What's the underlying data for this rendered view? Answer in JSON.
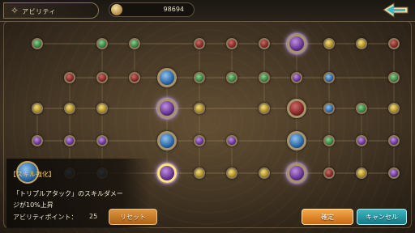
{
  "header": {
    "title": "アビリティ",
    "coin_count": "98694",
    "back_icon": "back-arrow-icon"
  },
  "board": {
    "nodes": [
      {
        "c": "green",
        "s": "s"
      },
      {
        "c": "green",
        "s": "s"
      },
      {
        "c": "green",
        "s": "s"
      },
      {
        "c": "red",
        "s": "s"
      },
      {
        "c": "red",
        "s": "s"
      },
      {
        "c": "red",
        "s": "s"
      },
      {
        "c": "purple",
        "s": "b"
      },
      {
        "c": "yellow",
        "s": "s"
      },
      {
        "c": "yellow",
        "s": "s"
      },
      {
        "c": "red",
        "s": "s"
      },
      {
        "c": "red",
        "s": "s"
      },
      {
        "c": "red",
        "s": "s"
      },
      {
        "c": "red",
        "s": "s"
      },
      {
        "c": "blue",
        "s": "b"
      },
      {
        "c": "green",
        "s": "s"
      },
      {
        "c": "green",
        "s": "s"
      },
      {
        "c": "green",
        "s": "s"
      },
      {
        "c": "purple",
        "s": "s"
      },
      {
        "c": "blue",
        "s": "s"
      },
      {
        "c": "green",
        "s": "s"
      },
      {
        "c": "yellow",
        "s": "s"
      },
      {
        "c": "yellow",
        "s": "s"
      },
      {
        "c": "yellow",
        "s": "s"
      },
      {
        "c": "purple",
        "s": "b"
      },
      {
        "c": "yellow",
        "s": "s"
      },
      {
        "c": "yellow",
        "s": "s"
      },
      {
        "c": "red",
        "s": "b"
      },
      {
        "c": "blue",
        "s": "s"
      },
      {
        "c": "green",
        "s": "s"
      },
      {
        "c": "yellow",
        "s": "s"
      },
      {
        "c": "purple",
        "s": "s"
      },
      {
        "c": "purple",
        "s": "s"
      },
      {
        "c": "purple",
        "s": "s"
      },
      {
        "c": "blue",
        "s": "b"
      },
      {
        "c": "purple",
        "s": "s"
      },
      {
        "c": "purple",
        "s": "s"
      },
      {
        "c": "blue",
        "s": "b"
      },
      {
        "c": "green",
        "s": "s"
      },
      {
        "c": "purple",
        "s": "s"
      },
      {
        "c": "purple",
        "s": "s"
      },
      {
        "c": "blue",
        "s": "s"
      },
      {
        "c": "blue",
        "s": "s"
      },
      {
        "c": "purple",
        "s": "b"
      },
      {
        "c": "yellow",
        "s": "s"
      },
      {
        "c": "yellow",
        "s": "s"
      },
      {
        "c": "yellow",
        "s": "s"
      },
      {
        "c": "purple",
        "s": "b"
      },
      {
        "c": "red",
        "s": "s"
      },
      {
        "c": "yellow",
        "s": "s"
      },
      {
        "c": "purple",
        "s": "s"
      }
    ]
  },
  "info": {
    "title": "【スキル強化】",
    "desc_line1": "「トリプルアタック」のスキルダメー",
    "desc_line2": "ジが10%上昇",
    "ap_label": "アビリティポイント：",
    "ap_value": "25"
  },
  "buttons": {
    "reset": "リセット",
    "confirm": "確定",
    "cancel": "キャンセル"
  }
}
